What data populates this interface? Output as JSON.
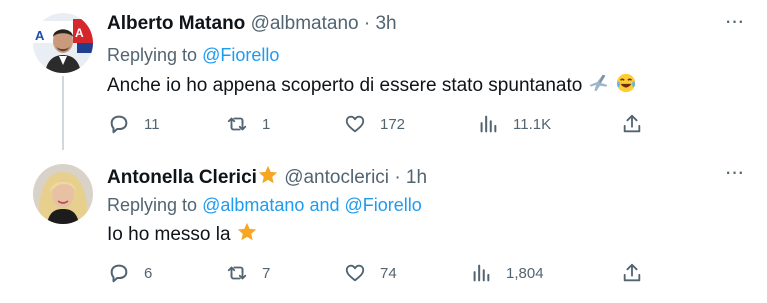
{
  "tweets": [
    {
      "name": "Alberto Matano",
      "handle": "@albmatano",
      "separator": "·",
      "time": "3h",
      "replying_prefix": "Replying to",
      "replying_to": [
        "@Fiorello"
      ],
      "replying_joiner": "",
      "text": "Anche io ho appena scoperto di essere stato spuntanato",
      "trailing_emoji": [
        "airplane-emoji",
        "tears-of-joy-emoji"
      ],
      "replies": "11",
      "retweets": "1",
      "likes": "172",
      "views": "11.1K"
    },
    {
      "name": "Antonella Clerici",
      "name_badge": "star-emoji",
      "handle": "@antoclerici",
      "separator": "·",
      "time": "1h",
      "replying_prefix": "Replying to",
      "replying_to": [
        "@albmatano",
        "@Fiorello"
      ],
      "replying_joiner": "and",
      "text": "Io ho messo la",
      "trailing_emoji": [
        "star-emoji"
      ],
      "replies": "6",
      "retweets": "7",
      "likes": "74",
      "views": "1,804"
    }
  ],
  "colors": {
    "text": "#0f1419",
    "secondary": "#536471",
    "link": "#1d9bf0",
    "star": "#f5a623",
    "thread_line": "#cfd9de"
  }
}
